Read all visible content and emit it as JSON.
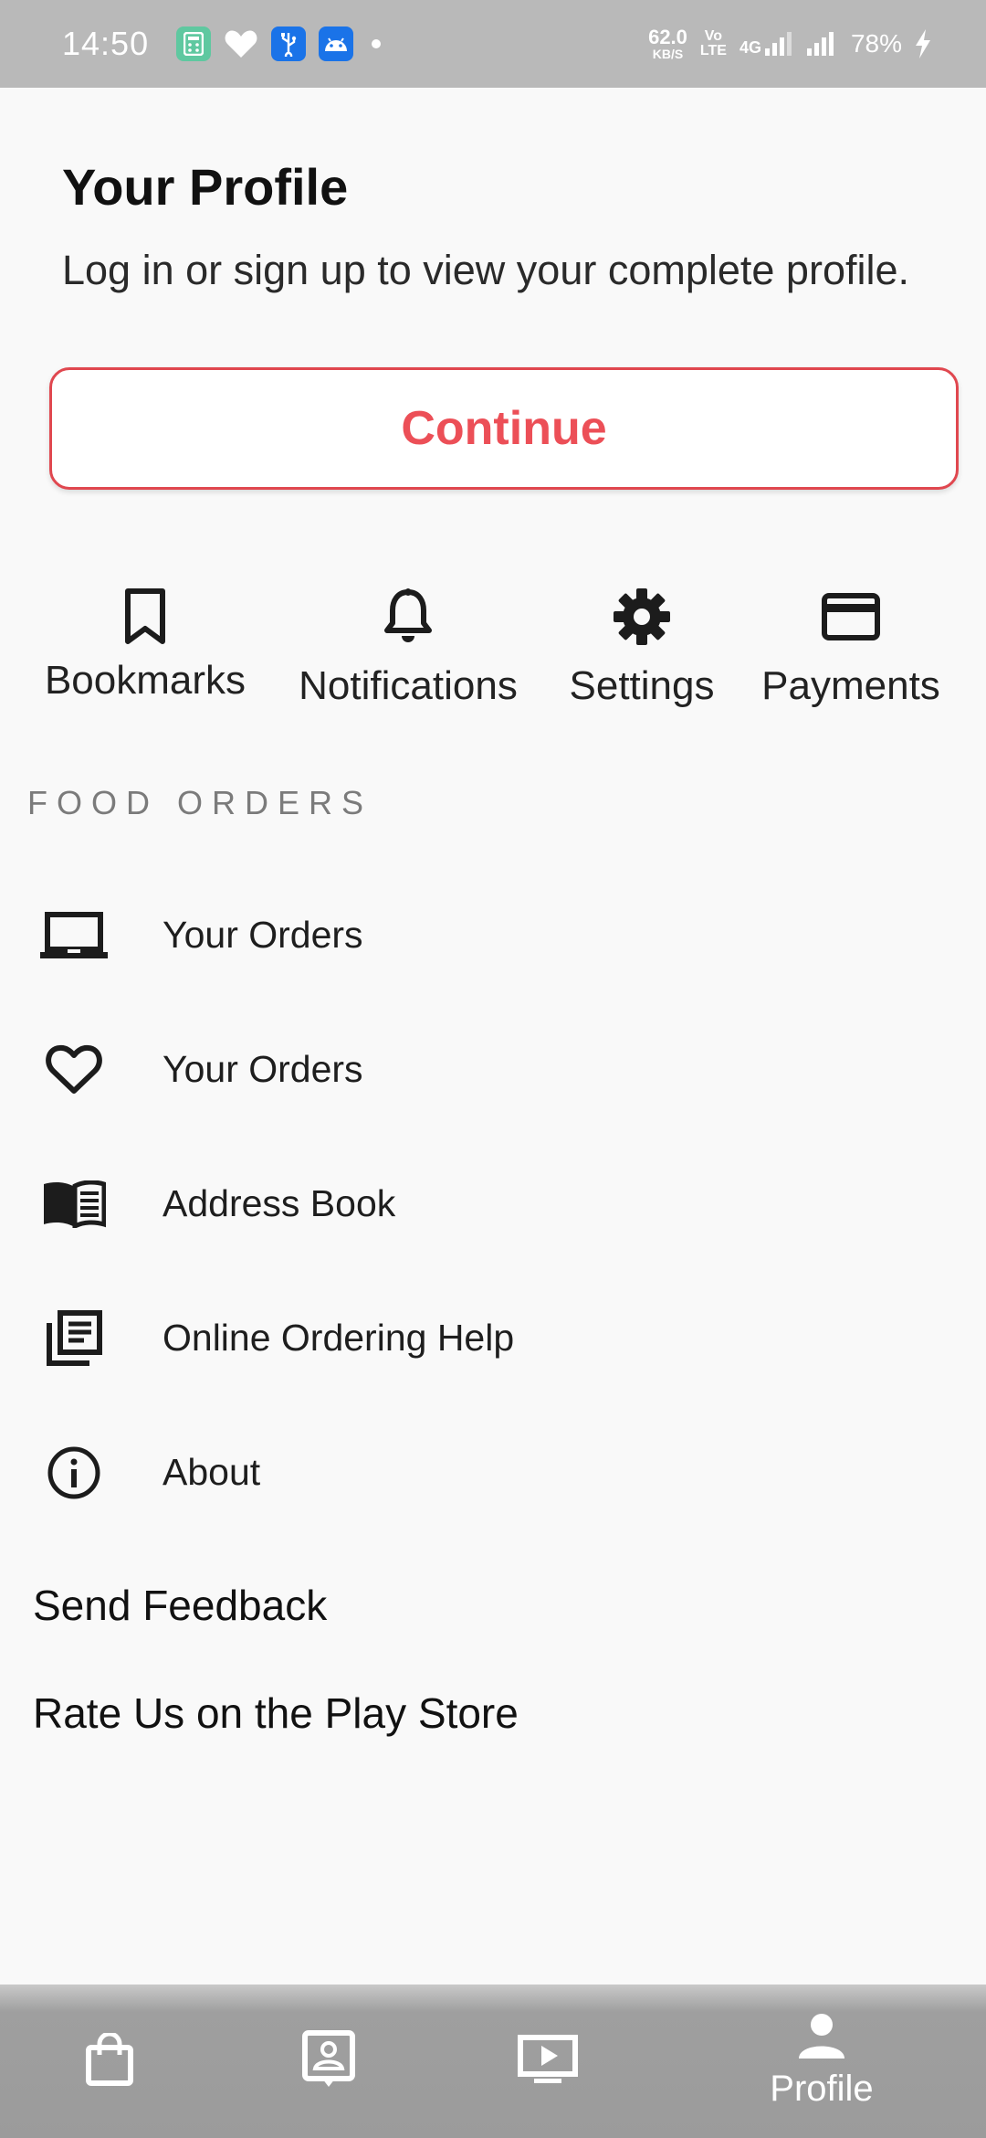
{
  "status_bar": {
    "time": "14:50",
    "net_speed_value": "62.0",
    "net_speed_unit": "KB/S",
    "volte_top": "Vo",
    "volte_bottom": "LTE",
    "network": "4G",
    "battery": "78%",
    "app_icons": [
      "calculator-app-icon",
      "health-app-icon",
      "usb-icon",
      "android-icon"
    ]
  },
  "profile": {
    "title": "Your Profile",
    "subtitle": "Log in or sign up to view your complete profile.",
    "continue_label": "Continue",
    "accent_color": "#ec4f57"
  },
  "quick_actions": [
    {
      "label": "Bookmarks",
      "icon": "bookmark-icon"
    },
    {
      "label": "Notifications",
      "icon": "bell-icon"
    },
    {
      "label": "Settings",
      "icon": "gear-icon"
    },
    {
      "label": "Payments",
      "icon": "credit-card-icon"
    }
  ],
  "food_orders": {
    "header": "FOOD ORDERS",
    "items": [
      {
        "label": "Your Orders",
        "icon": "laptop-icon"
      },
      {
        "label": "Your Orders",
        "icon": "heart-icon"
      },
      {
        "label": "Address Book",
        "icon": "open-book-icon"
      },
      {
        "label": "Online Ordering Help",
        "icon": "document-stack-icon"
      },
      {
        "label": "About",
        "icon": "info-icon"
      }
    ]
  },
  "links": {
    "send_feedback": "Send Feedback",
    "rate_us": "Rate Us on the Play Store"
  },
  "bottom_nav": {
    "items": [
      {
        "icon": "shopping-bag-icon",
        "label": ""
      },
      {
        "icon": "contact-card-icon",
        "label": ""
      },
      {
        "icon": "video-play-icon",
        "label": ""
      },
      {
        "icon": "person-icon",
        "label": "Profile"
      }
    ]
  }
}
